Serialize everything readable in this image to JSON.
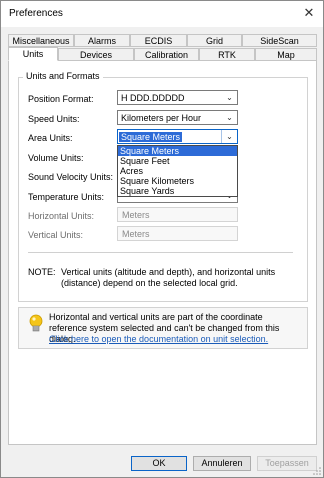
{
  "window": {
    "title": "Preferences",
    "close_glyph": "✕"
  },
  "tabs_row1": [
    "Miscellaneous",
    "Alarms",
    "ECDIS",
    "Grid",
    "SideScan"
  ],
  "tabs_row2": [
    "Units",
    "Devices",
    "Calibration",
    "RTK",
    "Map"
  ],
  "active_tab": "Units",
  "group": {
    "title": "Units and Formats",
    "fields": [
      {
        "label": "Position Format:",
        "value": "H DDD.DDDDD"
      },
      {
        "label": "Speed Units:",
        "value": "Kilometers per Hour"
      },
      {
        "label": "Area Units:",
        "value": "Square Meters"
      },
      {
        "label": "Volume Units:",
        "value": ""
      },
      {
        "label": "Sound Velocity Units:",
        "value": ""
      },
      {
        "label": "Temperature Units:",
        "value": ""
      },
      {
        "label": "Horizontal Units:",
        "value": "Meters"
      },
      {
        "label": "Vertical Units:",
        "value": "Meters"
      }
    ],
    "dropdown_options": [
      "Square Meters",
      "Square Feet",
      "Acres",
      "Square Kilometers",
      "Square Yards"
    ],
    "dropdown_selected": "Square Meters",
    "note_label": "NOTE:",
    "note_text": "Vertical units (altitude and depth), and horizontal units (distance) depend on the selected local grid."
  },
  "info": {
    "icon": "lightbulb-icon",
    "text": "Horizontal and vertical units are part of the coordinate reference system selected and can't be changed from this dialog.",
    "link": "Click here to open the documentation on unit selection."
  },
  "buttons": {
    "ok": "OK",
    "cancel": "Annuleren",
    "apply": "Toepassen"
  },
  "colors": {
    "accent": "#2d6bd7",
    "link": "#1a5bb8",
    "bulb": "#f5c518"
  }
}
